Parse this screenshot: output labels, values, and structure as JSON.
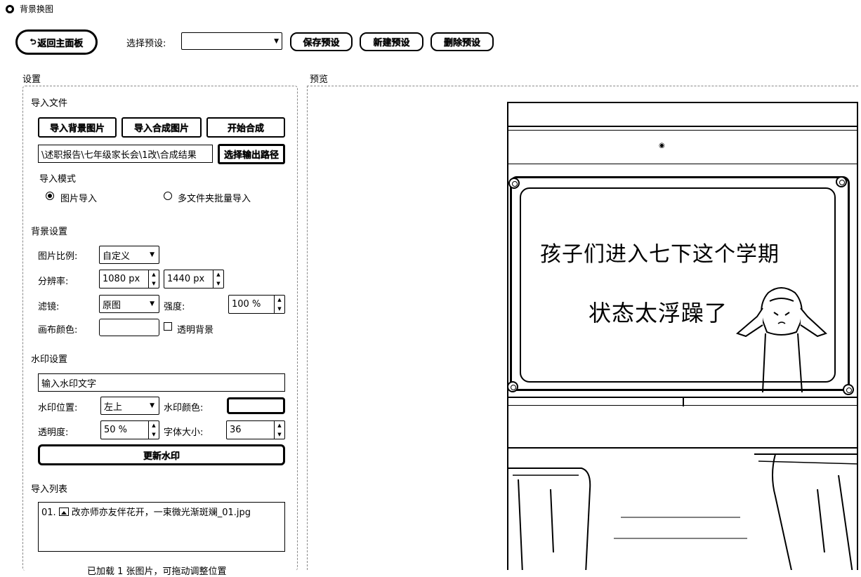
{
  "window": {
    "title": "背景换图"
  },
  "toolbar": {
    "back_label": "返回主面板",
    "preset_label": "选择预设:",
    "preset_value": "",
    "save_preset_label": "保存预设",
    "new_preset_label": "新建预设",
    "delete_preset_label": "删除预设"
  },
  "settings": {
    "header": "设置",
    "import_files": {
      "header": "导入文件",
      "import_bg_label": "导入背景图片",
      "import_composite_label": "导入合成图片",
      "start_composite_label": "开始合成",
      "output_path_value": "\\述职报告\\七年级家长会\\1改\\合成结果",
      "select_output_label": "选择输出路径"
    },
    "import_mode": {
      "header": "导入模式",
      "options": [
        "图片导入",
        "多文件夹批量导入"
      ],
      "selected": "图片导入"
    },
    "background": {
      "header": "背景设置",
      "ratio_label": "图片比例:",
      "ratio_value": "自定义",
      "resolution_label": "分辨率:",
      "width_value": "1080 px",
      "height_value": "1440 px",
      "filter_label": "滤镜:",
      "filter_value": "原图",
      "strength_label": "强度:",
      "strength_value": "100 %",
      "canvas_color_label": "画布颜色:",
      "canvas_color": "#ffffff",
      "transparent_label": "透明背景",
      "transparent_checked": false
    },
    "watermark": {
      "header": "水印设置",
      "text_placeholder": "输入水印文字",
      "position_label": "水印位置:",
      "position_value": "左上",
      "color_label": "水印颜色:",
      "color": "#ffffff",
      "opacity_label": "透明度:",
      "opacity_value": "50 %",
      "font_size_label": "字体大小:",
      "font_size_value": "36",
      "update_label": "更新水印"
    },
    "import_list": {
      "header": "导入列表",
      "items": [
        {
          "index": "01.",
          "icon": "image-icon",
          "name": "改亦师亦友伴花开，一束微光渐斑斓_01.jpg"
        }
      ],
      "status": "已加载 1 张图片，可拖动调整位置"
    }
  },
  "preview": {
    "header": "预览",
    "board_line1": "孩子们进入七下这个学期",
    "board_line2": "状态太浮躁了"
  }
}
